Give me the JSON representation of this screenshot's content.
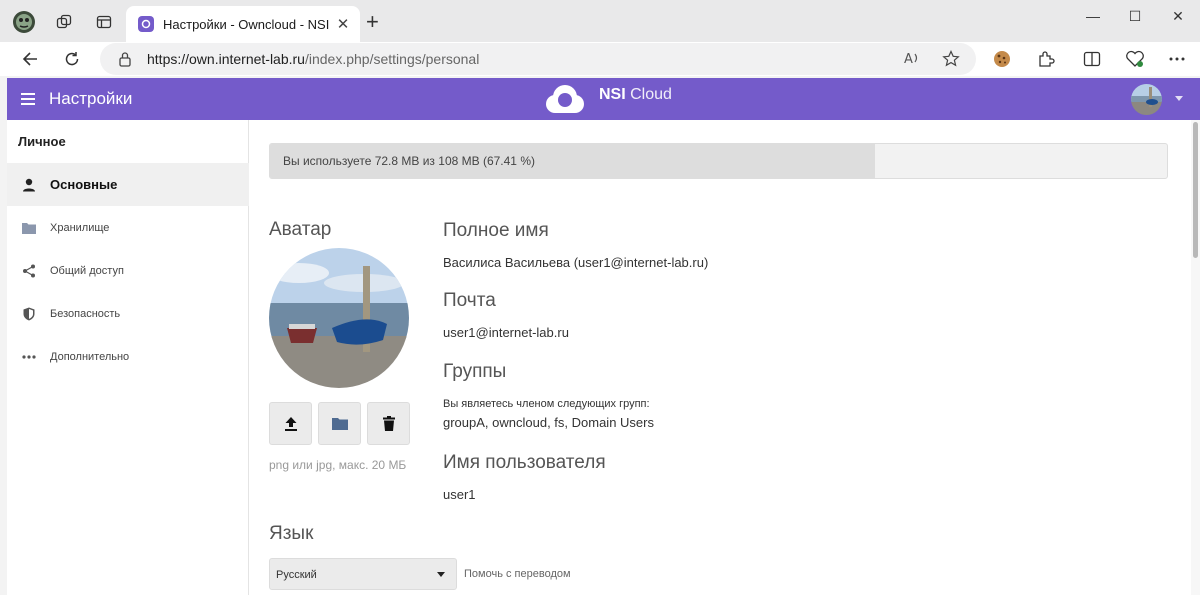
{
  "browser": {
    "tab_title": "Настройки - Owncloud - NSI",
    "close_glyph": "✕",
    "new_tab_glyph": "+",
    "url_host": "https://own.internet-lab.ru",
    "url_path": "/index.php/settings/personal",
    "window_controls": {
      "minimize": "—",
      "maximize": "☐",
      "close": "✕"
    }
  },
  "header": {
    "title": "Настройки",
    "brand_bold": "NSI",
    "brand_rest": " Cloud"
  },
  "sidebar": {
    "heading": "Личное",
    "items": [
      {
        "label": "Основные",
        "icon": "user-icon",
        "active": true
      },
      {
        "label": "Хранилище",
        "icon": "folder-icon"
      },
      {
        "label": "Общий доступ",
        "icon": "share-icon"
      },
      {
        "label": "Безопасность",
        "icon": "shield-icon"
      },
      {
        "label": "Дополнительно",
        "icon": "more-icon"
      }
    ]
  },
  "quota": {
    "text": "Вы используете 72.8 MB из 108 MB (67.41 %)",
    "percent": 67.41
  },
  "avatar": {
    "title": "Аватар",
    "hint": "png или jpg, макс. 20 МБ"
  },
  "profile": {
    "fullname_title": "Полное имя",
    "fullname_value": "Василиса Васильева (user1@internet-lab.ru)",
    "email_title": "Почта",
    "email_value": "user1@internet-lab.ru",
    "groups_title": "Группы",
    "groups_intro": "Вы являетесь членом следующих групп:",
    "groups_value": "groupA, owncloud, fs, Domain Users",
    "username_title": "Имя пользователя",
    "username_value": "user1"
  },
  "language": {
    "title": "Язык",
    "selected": "Русский",
    "help_link": "Помочь с переводом"
  },
  "colors": {
    "brand": "#745bca",
    "sidebar_active": "#f0f0f0",
    "quota_fill": "#dddddd"
  }
}
